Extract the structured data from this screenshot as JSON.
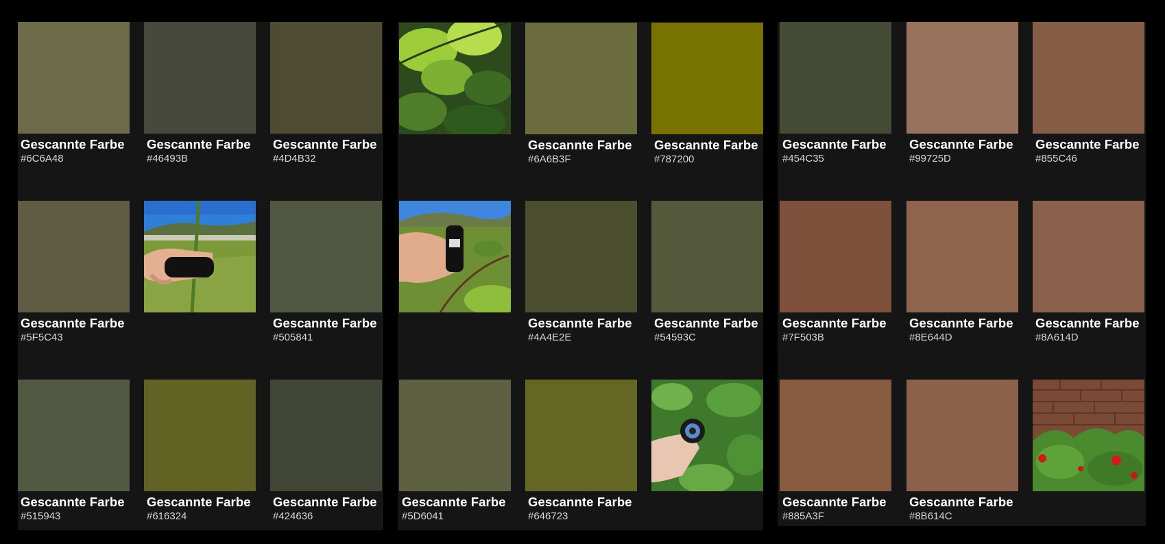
{
  "panels": [
    {
      "tiles": [
        {
          "kind": "color",
          "title": "Gescannte Farbe",
          "hex": "#6C6A48",
          "color": "#6C6A48"
        },
        {
          "kind": "color",
          "title": "Gescannte Farbe",
          "hex": "#46493B",
          "color": "#46493B"
        },
        {
          "kind": "color",
          "title": "Gescannte Farbe",
          "hex": "#4D4B32",
          "color": "#4D4B32"
        },
        {
          "kind": "color",
          "title": "Gescannte Farbe",
          "hex": "#5F5C43",
          "color": "#5F5C43"
        },
        {
          "kind": "photo",
          "icon": "photo-hand-scanner-field"
        },
        {
          "kind": "color",
          "title": "Gescannte Farbe",
          "hex": "#505841",
          "color": "#505841"
        },
        {
          "kind": "color",
          "title": "Gescannte Farbe",
          "hex": "#515943",
          "color": "#515943"
        },
        {
          "kind": "color",
          "title": "Gescannte Farbe",
          "hex": "#616324",
          "color": "#616324"
        },
        {
          "kind": "color",
          "title": "Gescannte Farbe",
          "hex": "#424636",
          "color": "#424636"
        }
      ]
    },
    {
      "tiles": [
        {
          "kind": "photo",
          "icon": "photo-leaves"
        },
        {
          "kind": "color",
          "title": "Gescannte Farbe",
          "hex": "#6A6B3F",
          "color": "#6A6B3F"
        },
        {
          "kind": "color",
          "title": "Gescannte Farbe",
          "hex": "#787200",
          "color": "#787200"
        },
        {
          "kind": "photo",
          "icon": "photo-hand-scanner-leaves"
        },
        {
          "kind": "color",
          "title": "Gescannte Farbe",
          "hex": "#4A4E2E",
          "color": "#4A4E2E"
        },
        {
          "kind": "color",
          "title": "Gescannte Farbe",
          "hex": "#54593C",
          "color": "#54593C"
        },
        {
          "kind": "color",
          "title": "Gescannte Farbe",
          "hex": "#5D6041",
          "color": "#5D6041"
        },
        {
          "kind": "color",
          "title": "Gescannte Farbe",
          "hex": "#646723",
          "color": "#646723"
        },
        {
          "kind": "photo",
          "icon": "photo-scanner-bush"
        }
      ]
    },
    {
      "tiles": [
        {
          "kind": "color",
          "title": "Gescannte Farbe",
          "hex": "#454C35",
          "color": "#454C35"
        },
        {
          "kind": "color",
          "title": "Gescannte Farbe",
          "hex": "#99725D",
          "color": "#99725D"
        },
        {
          "kind": "color",
          "title": "Gescannte Farbe",
          "hex": "#855C46",
          "color": "#855C46"
        },
        {
          "kind": "color",
          "title": "Gescannte Farbe",
          "hex": "#7F503B",
          "color": "#7F503B"
        },
        {
          "kind": "color",
          "title": "Gescannte Farbe",
          "hex": "#8E644D",
          "color": "#8E644D"
        },
        {
          "kind": "color",
          "title": "Gescannte Farbe",
          "hex": "#8A614D",
          "color": "#8A614D"
        },
        {
          "kind": "color",
          "title": "Gescannte Farbe",
          "hex": "#885A3F",
          "color": "#885A3F"
        },
        {
          "kind": "color",
          "title": "Gescannte Farbe",
          "hex": "#8B614C",
          "color": "#8B614C"
        },
        {
          "kind": "photo",
          "icon": "photo-brick-wall-roses"
        }
      ]
    }
  ]
}
